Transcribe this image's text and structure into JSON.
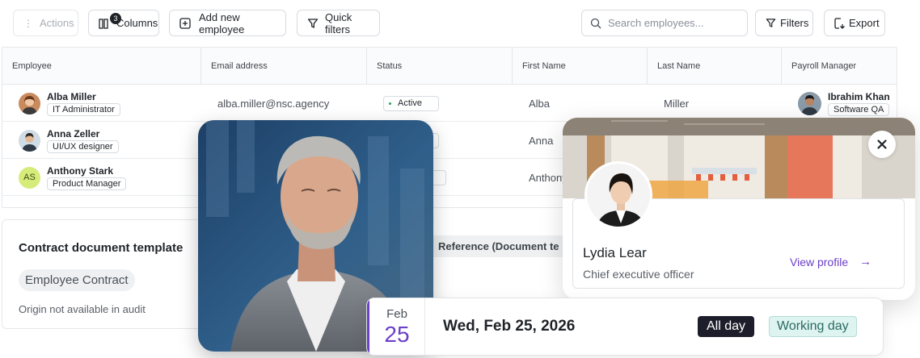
{
  "toolbar": {
    "actions_label": "Actions",
    "columns_label": "Columns",
    "columns_count": "3",
    "add_employee_label": "Add new employee",
    "quick_filters_label": "Quick filters",
    "search_placeholder": "Search employees...",
    "filters_label": "Filters",
    "export_label": "Export"
  },
  "table": {
    "columns": [
      "Employee",
      "Email address",
      "Status",
      "First Name",
      "Last Name",
      "Payroll Manager"
    ],
    "rows": [
      {
        "name": "Alba Miller",
        "role": "IT Administrator",
        "email": "alba.miller@nsc.agency",
        "status": "Active",
        "first_name": "Alba",
        "last_name": "Miller"
      },
      {
        "name": "Anna Zeller",
        "role": "UI/UX designer",
        "first_name": "Anna"
      },
      {
        "name": "Anthony Stark",
        "role": "Product Manager",
        "initials": "AS",
        "first_name": "Anthony"
      }
    ],
    "payroll_manager": {
      "name": "Ibrahim Khan",
      "role": "Software QA"
    }
  },
  "contract": {
    "title": "Contract document template",
    "chip": "Employee Contract",
    "note": "Origin not available in audit",
    "reference_label": "Reference (Document te"
  },
  "profile": {
    "name": "Lydia Lear",
    "title": "Chief executive officer",
    "link_label": "View profile",
    "link_arrow": "→"
  },
  "date": {
    "month": "Feb",
    "day": "25",
    "full": "Wed, Feb 25, 2026",
    "all_day": "All day",
    "working": "Working day"
  },
  "colors": {
    "accent": "#6b3fc9",
    "status_active": "#22a35a",
    "working_bg": "#def4f1",
    "dark_chip": "#1d1d2b"
  }
}
